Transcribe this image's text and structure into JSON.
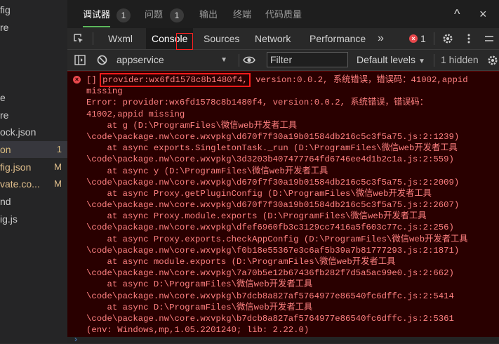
{
  "explorer": {
    "files": [
      {
        "name": "fig",
        "badge": "",
        "style": "plain"
      },
      {
        "name": "re",
        "badge": "",
        "style": "plain"
      },
      {
        "name": "e",
        "badge": "",
        "style": "plain"
      },
      {
        "name": "re",
        "badge": "",
        "style": "plain"
      },
      {
        "name": "ock.json",
        "badge": "",
        "style": "plain"
      },
      {
        "name": "on",
        "badge": "1",
        "style": "gold"
      },
      {
        "name": "fig.json",
        "badge": "M",
        "style": "orange"
      },
      {
        "name": "vate.co...",
        "badge": "M",
        "style": "orange"
      },
      {
        "name": "nd",
        "badge": "",
        "style": "plain"
      },
      {
        "name": "ig.js",
        "badge": "",
        "style": "plain"
      }
    ]
  },
  "panel_tabs": {
    "debugger": "调试器",
    "debugger_count": "1",
    "issues": "问题",
    "issues_count": "1",
    "output": "输出",
    "terminal": "终端",
    "code_quality": "代码质量",
    "collapse": "^",
    "close": "×"
  },
  "devtools_tabs": {
    "wxml": "Wxml",
    "console": "Console",
    "sources": "Sources",
    "network": "Network",
    "performance": "Performance",
    "more": "»",
    "error_count": "1",
    "error_glyph": "×"
  },
  "console_toolbar": {
    "context": "appservice",
    "filter_placeholder": "Filter",
    "levels": "Default levels",
    "hidden": "1 hidden"
  },
  "error": {
    "prefix": "[] ",
    "highlight": "provider:wx6fd1578c8b1480f4,",
    "lines": [
      " version:0.0.2, 系统错误，错误码：41002,appid",
      "missing",
      "Error: provider:wx6fd1578c8b1480f4, version:0.0.2, 系统错误，错误码：",
      "41002,appid missing",
      "    at g (D:\\ProgramFiles\\微信web开发者工具",
      "\\code\\package.nw\\core.wxvpkg\\d670f7f30a19b01584db216c5c3f5a75.js:2:1239)",
      "    at async exports.SingletonTask._run (D:\\ProgramFiles\\微信web开发者工具",
      "\\code\\package.nw\\core.wxvpkg\\3d3203b407477764fd6746ee4d1b2c1a.js:2:559)",
      "    at async y (D:\\ProgramFiles\\微信web开发者工具",
      "\\code\\package.nw\\core.wxvpkg\\d670f7f30a19b01584db216c5c3f5a75.js:2:2009)",
      "    at async Proxy.getPluginConfig (D:\\ProgramFiles\\微信web开发者工具",
      "\\code\\package.nw\\core.wxvpkg\\d670f7f30a19b01584db216c5c3f5a75.js:2:2607)",
      "    at async Proxy.module.exports (D:\\ProgramFiles\\微信web开发者工具",
      "\\code\\package.nw\\core.wxvpkg\\dfef6960fb3c3129cc7416a5f603c77c.js:2:256)",
      "    at async Proxy.exports.checkAppConfig (D:\\ProgramFiles\\微信web开发者工具",
      "\\code\\package.nw\\core.wxvpkg\\f0b18e55367e3c6af5b39a7b81777293.js:2:1871)",
      "    at async module.exports (D:\\ProgramFiles\\微信web开发者工具",
      "\\code\\package.nw\\core.wxvpkg\\7a70b5e12b67436fb282f7d5a5ac99e0.js:2:662)",
      "    at async D:\\ProgramFiles\\微信web开发者工具",
      "\\code\\package.nw\\core.wxvpkg\\b7dcb8a827af5764977e86540fc6dffc.js:2:5414",
      "    at async D:\\ProgramFiles\\微信web开发者工具",
      "\\code\\package.nw\\core.wxvpkg\\b7dcb8a827af5764977e86540fc6dffc.js:2:5361",
      "(env: Windows,mp,1.05.2201240; lib: 2.22.0)"
    ]
  },
  "colors": {
    "error_text": "#ff8080",
    "error_bg": "#290000",
    "highlight_border": "#ff1a1a",
    "active_tab_underline": "#5cb85c"
  },
  "icons": [
    "inspect-icon",
    "panel-toggle-icon",
    "clear-console-icon",
    "eye-icon",
    "gear-icon",
    "kebab-menu-icon",
    "settings-icon",
    "error-icon",
    "chevron-down-icon"
  ]
}
